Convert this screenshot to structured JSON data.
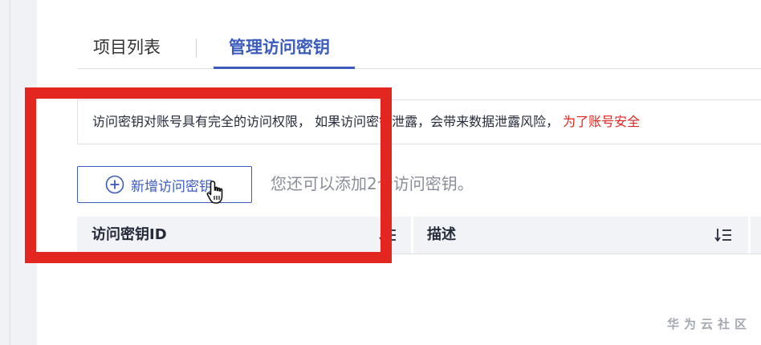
{
  "tabs": {
    "projects_label": "项目列表",
    "keys_label": "管理访问密钥"
  },
  "notice": {
    "text": "访问密钥对账号具有完全的访问权限， 如果访问密钥泄露，会带来数据泄露风险，",
    "warning": " 为了账号安全"
  },
  "actions": {
    "add_button_label": "新增访问密钥",
    "hint_text": "您还可以添加2个访问密钥。"
  },
  "table": {
    "columns": [
      {
        "label": "访问密钥ID"
      },
      {
        "label": "描述"
      }
    ]
  },
  "watermark": "华为云社区",
  "colors": {
    "accent": "#3b5bbf",
    "warning": "#e0241c",
    "highlight": "#e3261f"
  }
}
